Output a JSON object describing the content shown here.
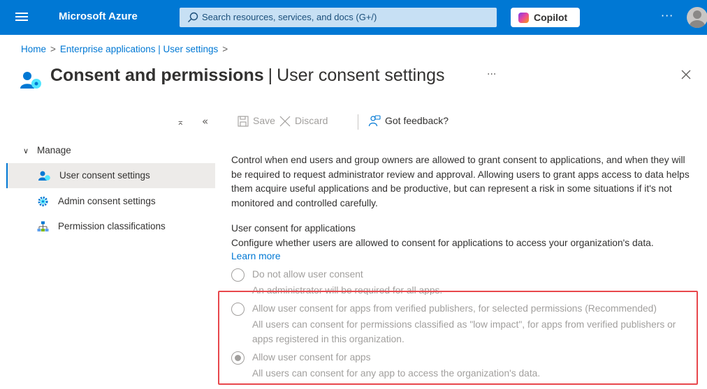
{
  "topbar": {
    "brand": "Microsoft Azure",
    "search_placeholder": "Search resources, services, and docs (G+/)",
    "copilot_label": "Copilot",
    "more_label": "···"
  },
  "breadcrumb": {
    "home": "Home",
    "sep": ">",
    "parent": "Enterprise applications | User settings"
  },
  "title": {
    "main": "Consent and permissions",
    "divider": "|",
    "sub": "User consent settings",
    "more_label": "···"
  },
  "sidebar": {
    "collapse_label": "⌅",
    "collapse2_label": "«",
    "group_label": "Manage",
    "items": [
      {
        "label": "User consent settings",
        "active": true,
        "icon": "user-consent-icon"
      },
      {
        "label": "Admin consent settings",
        "active": false,
        "icon": "gear-icon"
      },
      {
        "label": "Permission classifications",
        "active": false,
        "icon": "hierarchy-icon"
      }
    ]
  },
  "commandbar": {
    "save": "Save",
    "discard": "Discard",
    "feedback": "Got feedback?"
  },
  "content": {
    "description": "Control when end users and group owners are allowed to grant consent to applications, and when they will be required to request administrator review and approval. Allowing users to grant apps access to data helps them acquire useful applications and be productive, but can represent a risk in some situations if it's not monitored and controlled carefully.",
    "section_title": "User consent for applications",
    "section_desc": "Configure whether users are allowed to consent for applications to access your organization's data.",
    "learn_more": "Learn more",
    "options": [
      {
        "label": "Do not allow user consent",
        "sub": "An administrator will be required for all apps.",
        "selected": false
      },
      {
        "label": "Allow user consent for apps from verified publishers, for selected permissions (Recommended)",
        "sub": "All users can consent for permissions classified as \"low impact\", for apps from verified publishers or apps registered in this organization.",
        "selected": false
      },
      {
        "label": "Allow user consent for apps",
        "sub": "All users can consent for any app to access the organization's data.",
        "selected": true
      }
    ]
  },
  "colors": {
    "accent": "#0078d4",
    "highlight_border": "#e8474c",
    "disabled_text": "#a19f9d"
  }
}
